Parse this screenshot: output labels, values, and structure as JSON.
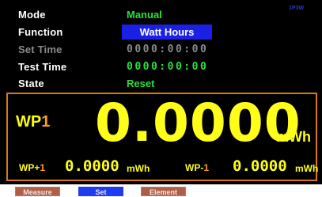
{
  "status": {
    "id_text": "1P3W"
  },
  "settings": {
    "mode": {
      "label": "Mode",
      "value": "Manual"
    },
    "function": {
      "label": "Function",
      "value": "Watt Hours"
    },
    "set_time": {
      "label": "Set Time",
      "value": "0000:00:00"
    },
    "test_time": {
      "label": "Test Time",
      "value": "0000:00:00"
    },
    "state": {
      "label": "State",
      "value": "Reset"
    }
  },
  "main": {
    "label_prefix": "WP",
    "label_index": "1",
    "value": "0.0000",
    "unit": "mWh"
  },
  "sub_plus": {
    "label_prefix": "WP+",
    "label_index": "1",
    "value": "0.0000",
    "unit": "mWh"
  },
  "sub_minus": {
    "label_prefix": "WP-",
    "label_index": "1",
    "value": "0.0000",
    "unit": "mWh"
  },
  "softkeys": {
    "measure": "Measure",
    "set": "Set",
    "element": "Element"
  },
  "colors": {
    "value_green": "#28e23a",
    "reading_yellow": "#ffff1a",
    "panel_border": "#d97a10",
    "function_highlight": "#1a20e6"
  }
}
